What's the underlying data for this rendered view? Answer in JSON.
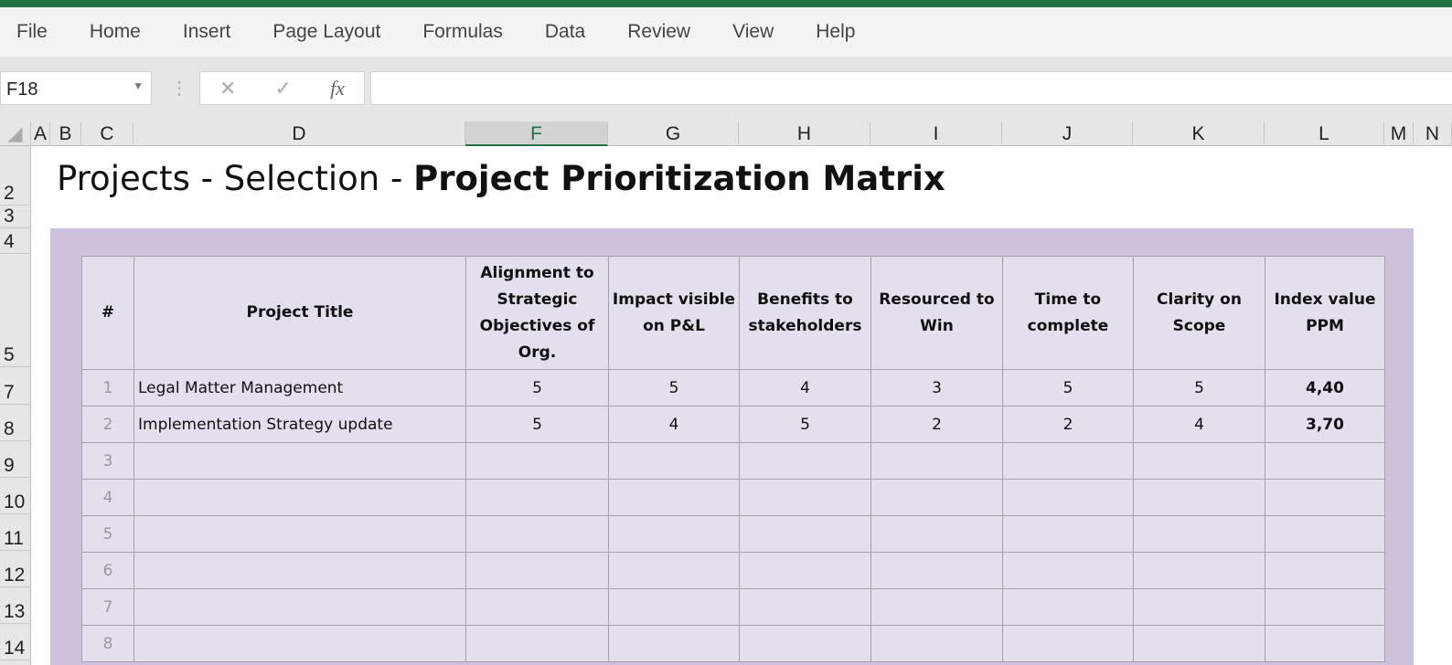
{
  "ribbon": {
    "tabs": [
      "File",
      "Home",
      "Insert",
      "Page Layout",
      "Formulas",
      "Data",
      "Review",
      "View",
      "Help"
    ]
  },
  "formula_bar": {
    "name_box": "F18",
    "cancel": "✕",
    "enter": "✓",
    "fx": "fx",
    "value": ""
  },
  "columns": [
    "A",
    "B",
    "C",
    "D",
    "F",
    "G",
    "H",
    "I",
    "J",
    "K",
    "L",
    "M",
    "N"
  ],
  "selected_column": "F",
  "rows": [
    "2",
    "3",
    "4",
    "5",
    "7",
    "8",
    "9",
    "10",
    "11",
    "12",
    "13",
    "14"
  ],
  "title": {
    "normal": "Projects - Selection - ",
    "bold": "Project Prioritization Matrix"
  },
  "table": {
    "headers": [
      "#",
      "Project Title",
      "Alignment to Strategic Objectives of Org.",
      "Impact visible on P&L",
      "Benefits to stakeholders",
      "Resourced to Win",
      "Time to complete",
      "Clarity on Scope",
      "Index value PPM"
    ],
    "rows": [
      [
        "1",
        "Legal Matter Management",
        "5",
        "5",
        "4",
        "3",
        "5",
        "5",
        "4,40"
      ],
      [
        "2",
        "Implementation Strategy update",
        "5",
        "4",
        "5",
        "2",
        "2",
        "4",
        "3,70"
      ],
      [
        "3",
        "",
        "",
        "",
        "",
        "",
        "",
        "",
        ""
      ],
      [
        "4",
        "",
        "",
        "",
        "",
        "",
        "",
        "",
        ""
      ],
      [
        "5",
        "",
        "",
        "",
        "",
        "",
        "",
        "",
        ""
      ],
      [
        "6",
        "",
        "",
        "",
        "",
        "",
        "",
        "",
        ""
      ],
      [
        "7",
        "",
        "",
        "",
        "",
        "",
        "",
        "",
        ""
      ],
      [
        "8",
        "",
        "",
        "",
        "",
        "",
        "",
        "",
        ""
      ]
    ]
  }
}
